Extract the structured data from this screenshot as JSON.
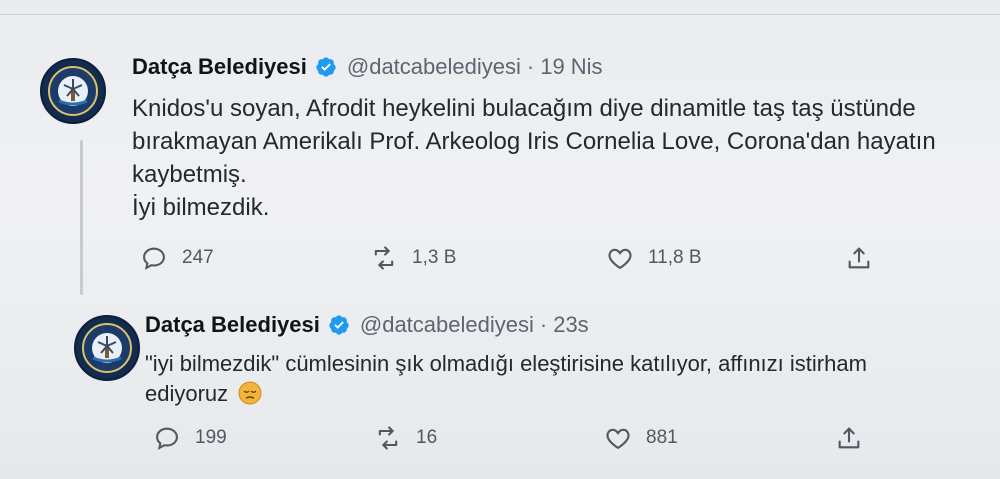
{
  "tweets": [
    {
      "name": "Datça Belediyesi",
      "handle": "@datcabelediyesi",
      "separator": "·",
      "time": "19 Nis",
      "lines": [
        "Knidos'u soyan, Afrodit heykelini bulacağım diye dinamitle taş taş üstünde",
        "bırakmayan Amerikalı Prof. Arkeolog Iris Cornelia Love, Corona'dan hayatın",
        "kaybetmiş.",
        "İyi bilmezdik."
      ],
      "replies": "247",
      "retweets": "1,3 B",
      "likes": "11,8 B"
    },
    {
      "name": "Datça Belediyesi",
      "handle": "@datcabelediyesi",
      "separator": "·",
      "time": "23s",
      "lines": [
        "\"iyi bilmezdik\" cümlesinin şık olmadığı eleştirisine katılıyor, affınızı istirham",
        "ediyoruz"
      ],
      "replies": "199",
      "retweets": "16",
      "likes": "881"
    }
  ],
  "icons": {
    "reply": "reply-icon",
    "retweet": "retweet-icon",
    "like": "heart-icon",
    "share": "share-icon",
    "verified": "verified-badge-icon",
    "emoji": "pensive-face-emoji"
  },
  "colors": {
    "verified": "#1d9bf0",
    "avatar_bg": "#132b4f"
  }
}
